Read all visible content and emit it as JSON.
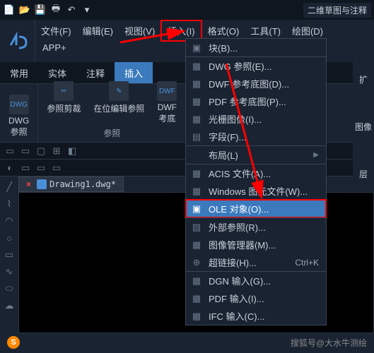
{
  "titlebar": {
    "mode": "二维草图与注释"
  },
  "menubar": {
    "file": "文件(F)",
    "edit": "编辑(E)",
    "view": "视图(V)",
    "insert": "插入(I)",
    "format": "格式(O)",
    "tools": "工具(T)",
    "draw": "绘图(D)",
    "app_plus": "APP+"
  },
  "tabs": {
    "common": "常用",
    "entity": "实体",
    "annotate": "注释",
    "insert": "插入",
    "ext": "扩"
  },
  "ribbon": {
    "dwg_ref": "DWG\n参照",
    "clip": "参照剪裁",
    "inplace": "在位编辑参照",
    "dwf": "DWF\n考底",
    "group": "参照",
    "r_image": "图像",
    "r_layer": "层"
  },
  "dropdown": {
    "block": "块(B)...",
    "dwg_ref": "DWG 参照(E)...",
    "dwf_ref": "DWF 参考底图(D)...",
    "pdf_ref": "PDF 参考底图(P)...",
    "raster": "光栅图像(I)...",
    "field": "字段(F)...",
    "layout": "布局(L)",
    "acis": "ACIS 文件(A)...",
    "wmf": "Windows 图元文件(W)...",
    "ole": "OLE 对象(O)...",
    "xref": "外部参照(R)...",
    "imgmgr": "图像管理器(M)...",
    "hyperlink": "超链接(H)...",
    "hyperlink_sc": "Ctrl+K",
    "dgn": "DGN 输入(G)...",
    "pdf": "PDF 输入(I)...",
    "ifc": "IFC 输入(C)..."
  },
  "doc": {
    "name": "Drawing1.dwg*"
  },
  "watermark": "搜狐号@大水牛测绘"
}
